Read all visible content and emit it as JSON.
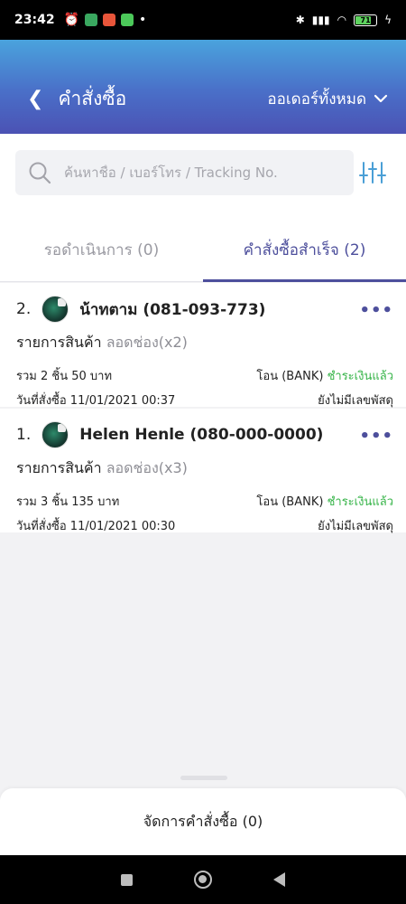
{
  "status": {
    "time": "23:42",
    "battery": "71"
  },
  "header": {
    "title": "คำสั่งซื้อ",
    "filter_label": "ออเดอร์ทั้งหมด"
  },
  "search": {
    "placeholder": "ค้นหาชื่อ / เบอร์โทร / Tracking No."
  },
  "tabs": [
    {
      "label": "รอดำเนินการ (0)",
      "active": false
    },
    {
      "label": "คำสั่งซื้อสำเร็จ (2)",
      "active": true
    }
  ],
  "orders": [
    {
      "number": "2.",
      "customer": "น้าทตาม (081-093-773)",
      "items_label": "รายการสินค้า",
      "items_detail": "ลอดช่อง(x2)",
      "total": "รวม 2 ชิ้น 50 บาท",
      "payment_method": "โอน (BANK)",
      "payment_status": "ชำระเงินแล้ว",
      "date": "วันที่สั่งซื้อ 11/01/2021 00:37",
      "tracking": "ยังไม่มีเลขพัสดุ"
    },
    {
      "number": "1.",
      "customer": "Helen Henle (080-000-0000)",
      "items_label": "รายการสินค้า",
      "items_detail": "ลอดช่อง(x3)",
      "total": "รวม 3 ชิ้น 135 บาท",
      "payment_method": "โอน (BANK)",
      "payment_status": "ชำระเงินแล้ว",
      "date": "วันที่สั่งซื้อ 11/01/2021 00:30",
      "tracking": "ยังไม่มีเลขพัสดุ"
    }
  ],
  "footer": {
    "manage_label": "จัดการคำสั่งซื้อ (0)"
  },
  "colors": {
    "accent": "#4d4f9c",
    "paid": "#37b449",
    "header_top": "#4aa3dd",
    "header_bottom": "#4b52b4"
  }
}
